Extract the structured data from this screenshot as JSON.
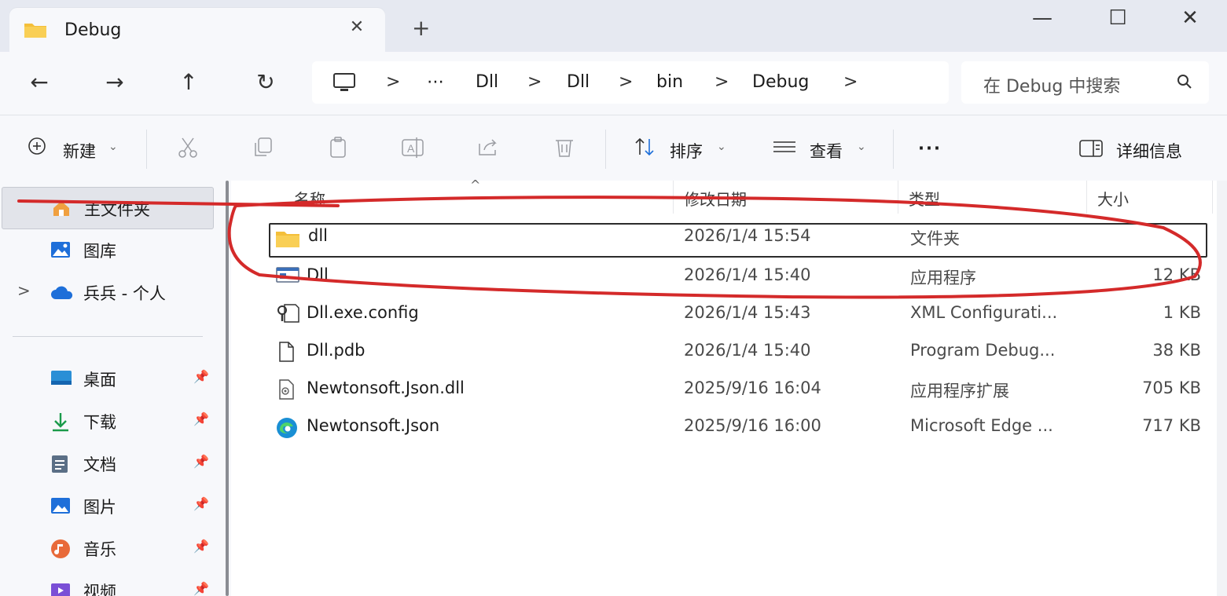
{
  "window": {
    "tab_title": "Debug",
    "tab_close": "✕",
    "new_tab": "+",
    "minimize": "—",
    "maximize": "☐",
    "close": "✕"
  },
  "nav": {
    "back": "←",
    "forward": "→",
    "up": "↑",
    "refresh": "↻",
    "breadcrumb": [
      "⋯",
      "Dll",
      "Dll",
      "bin",
      "Debug"
    ],
    "separator": ">",
    "search_placeholder": "在 Debug 中搜索"
  },
  "toolbar": {
    "new_label": "新建",
    "sort_label": "排序",
    "view_label": "查看",
    "more_label": "···",
    "details_label": "详细信息"
  },
  "sidebar": {
    "items": [
      {
        "label": "主文件夹",
        "icon": "home-icon"
      },
      {
        "label": "图库",
        "icon": "gallery-icon"
      },
      {
        "label": "兵兵 - 个人",
        "icon": "onedrive-icon"
      }
    ],
    "expand_glyph": ">",
    "pinned": [
      {
        "label": "桌面",
        "icon": "desktop-icon"
      },
      {
        "label": "下载",
        "icon": "download-icon"
      },
      {
        "label": "文档",
        "icon": "documents-icon"
      },
      {
        "label": "图片",
        "icon": "pictures-icon"
      },
      {
        "label": "音乐",
        "icon": "music-icon"
      },
      {
        "label": "视频",
        "icon": "videos-icon"
      }
    ],
    "pin_glyph": "📌"
  },
  "columns": {
    "name": "名称",
    "modified": "修改日期",
    "type": "类型",
    "size": "大小"
  },
  "files": [
    {
      "name": "dll",
      "modified": "2026/1/4 15:54",
      "type": "文件夹",
      "size": "",
      "icon": "folder-icon"
    },
    {
      "name": "Dll",
      "modified": "2026/1/4 15:40",
      "type": "应用程序",
      "size": "12 KB",
      "icon": "exe-icon"
    },
    {
      "name": "Dll.exe.config",
      "modified": "2026/1/4 15:43",
      "type": "XML Configurati...",
      "size": "1 KB",
      "icon": "config-icon"
    },
    {
      "name": "Dll.pdb",
      "modified": "2026/1/4 15:40",
      "type": "Program Debug...",
      "size": "38 KB",
      "icon": "file-icon"
    },
    {
      "name": "Newtonsoft.Json.dll",
      "modified": "2025/9/16 16:04",
      "type": "应用程序扩展",
      "size": "705 KB",
      "icon": "dll-icon"
    },
    {
      "name": "Newtonsoft.Json",
      "modified": "2025/9/16 16:00",
      "type": "Microsoft Edge ...",
      "size": "717 KB",
      "icon": "edge-icon"
    }
  ],
  "colors": {
    "annotation_red": "#d42a2a",
    "folder_yellow": "#f4bf3a",
    "accent_blue": "#1e6fd9"
  }
}
